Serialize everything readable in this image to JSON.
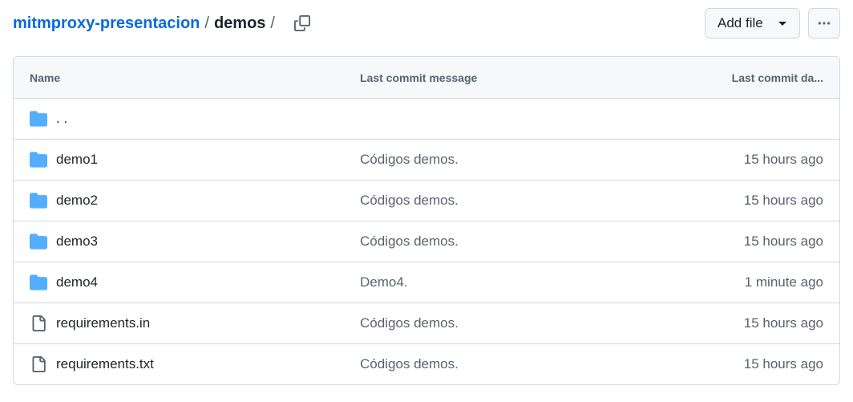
{
  "breadcrumb": {
    "repo": "mitmproxy-presentacion",
    "separator": "/",
    "current": "demos",
    "trailing": "/"
  },
  "actions": {
    "add_file_label": "Add file"
  },
  "table": {
    "headers": {
      "name": "Name",
      "message": "Last commit message",
      "date": "Last commit da..."
    },
    "parent_row": {
      "name": ". ."
    },
    "rows": [
      {
        "type": "folder",
        "name": "demo1",
        "message": "Códigos demos.",
        "date": "15 hours ago"
      },
      {
        "type": "folder",
        "name": "demo2",
        "message": "Códigos demos.",
        "date": "15 hours ago"
      },
      {
        "type": "folder",
        "name": "demo3",
        "message": "Códigos demos.",
        "date": "15 hours ago"
      },
      {
        "type": "folder",
        "name": "demo4",
        "message": "Demo4.",
        "date": "1 minute ago"
      },
      {
        "type": "file",
        "name": "requirements.in",
        "message": "Códigos demos.",
        "date": "15 hours ago"
      },
      {
        "type": "file",
        "name": "requirements.txt",
        "message": "Códigos demos.",
        "date": "15 hours ago"
      }
    ]
  },
  "icons": {
    "folder": "folder-icon",
    "file": "file-icon",
    "copy": "copy-icon",
    "more": "kebab-horizontal-icon",
    "caret": "triangle-down-icon"
  },
  "colors": {
    "link": "#0969da",
    "folder": "#54aeff",
    "muted": "#59636e",
    "border": "#d1d9e0",
    "header_bg": "#f6f8fa"
  }
}
